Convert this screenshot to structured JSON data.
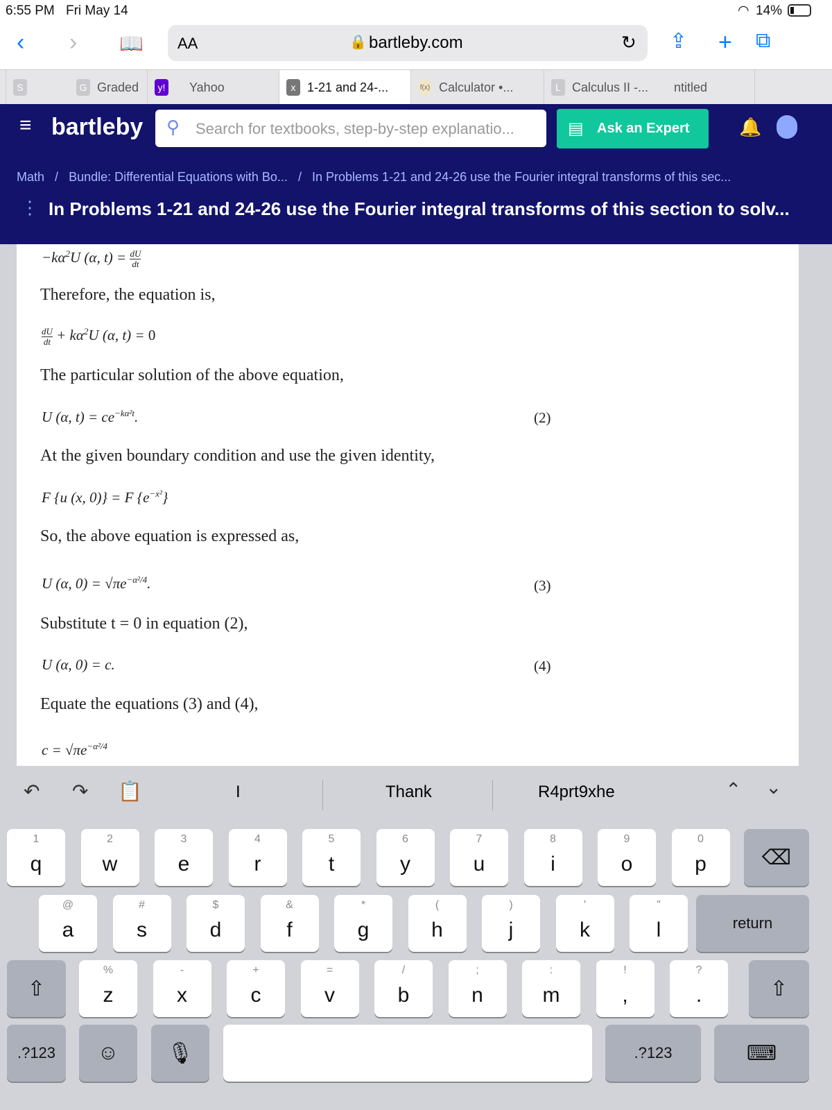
{
  "status": {
    "time": "6:55 PM",
    "date": "Fri May 14",
    "battery": "14%"
  },
  "browser": {
    "text_size": "AA",
    "url": "bartleby.com",
    "tabs": [
      {
        "label": "",
        "favicon": "S"
      },
      {
        "label": "Graded",
        "favicon": "G"
      },
      {
        "label": "Yahoo",
        "favicon": "y!"
      },
      {
        "label": "1-21 and 24-...",
        "favicon": "x",
        "active": true
      },
      {
        "label": "Calculator •...",
        "favicon": "f(x)"
      },
      {
        "label": "Calculus II -...",
        "favicon": "L"
      },
      {
        "label": "ntitled",
        "favicon": ""
      }
    ]
  },
  "site": {
    "logo": "bartleby",
    "search_placeholder": "Search for textbooks, step-by-step explanatio...",
    "ask_label": "Ask an Expert",
    "accent": "#10c89c",
    "nav_bg": "#13136b"
  },
  "breadcrumb": [
    "Math",
    "Bundle: Differential Equations with Bo...",
    "In Problems 1-21 and 24-26 use the Fourier integral transforms of this sec..."
  ],
  "page_title": "In Problems 1-21 and 24-26 use the Fourier integral transforms of this section to solv...",
  "content": {
    "p1": "Therefore, the equation is,",
    "p2": "The particular solution of the above equation,",
    "p3": "At the given boundary condition and use the given identity,",
    "p4": "So, the above equation is expressed as,",
    "p5": "Substitute t = 0 in equation (2),",
    "p6": "Equate the equations (3) and (4),",
    "eq2": "(2)",
    "eq3": "(3)",
    "eq4": "(4)"
  },
  "keyboard": {
    "suggestions": [
      "I",
      "Thank",
      "R4prt9xhe"
    ],
    "row1": [
      [
        "1",
        "q"
      ],
      [
        "2",
        "w"
      ],
      [
        "3",
        "e"
      ],
      [
        "4",
        "r"
      ],
      [
        "5",
        "t"
      ],
      [
        "6",
        "y"
      ],
      [
        "7",
        "u"
      ],
      [
        "8",
        "i"
      ],
      [
        "9",
        "o"
      ],
      [
        "0",
        "p"
      ]
    ],
    "row2": [
      [
        "@",
        "a"
      ],
      [
        "#",
        "s"
      ],
      [
        "$",
        "d"
      ],
      [
        "&",
        "f"
      ],
      [
        "*",
        "g"
      ],
      [
        "(",
        "h"
      ],
      [
        ")",
        "j"
      ],
      [
        "'",
        "k"
      ],
      [
        "\"",
        "l"
      ]
    ],
    "row3": [
      [
        "%",
        "z"
      ],
      [
        "-",
        "x"
      ],
      [
        "+",
        "c"
      ],
      [
        "=",
        "v"
      ],
      [
        "/",
        "b"
      ],
      [
        ";",
        "n"
      ],
      [
        ":",
        "m"
      ],
      [
        "!",
        ","
      ],
      [
        "?",
        "."
      ]
    ],
    "return": "return",
    "numbers": ".?123"
  }
}
